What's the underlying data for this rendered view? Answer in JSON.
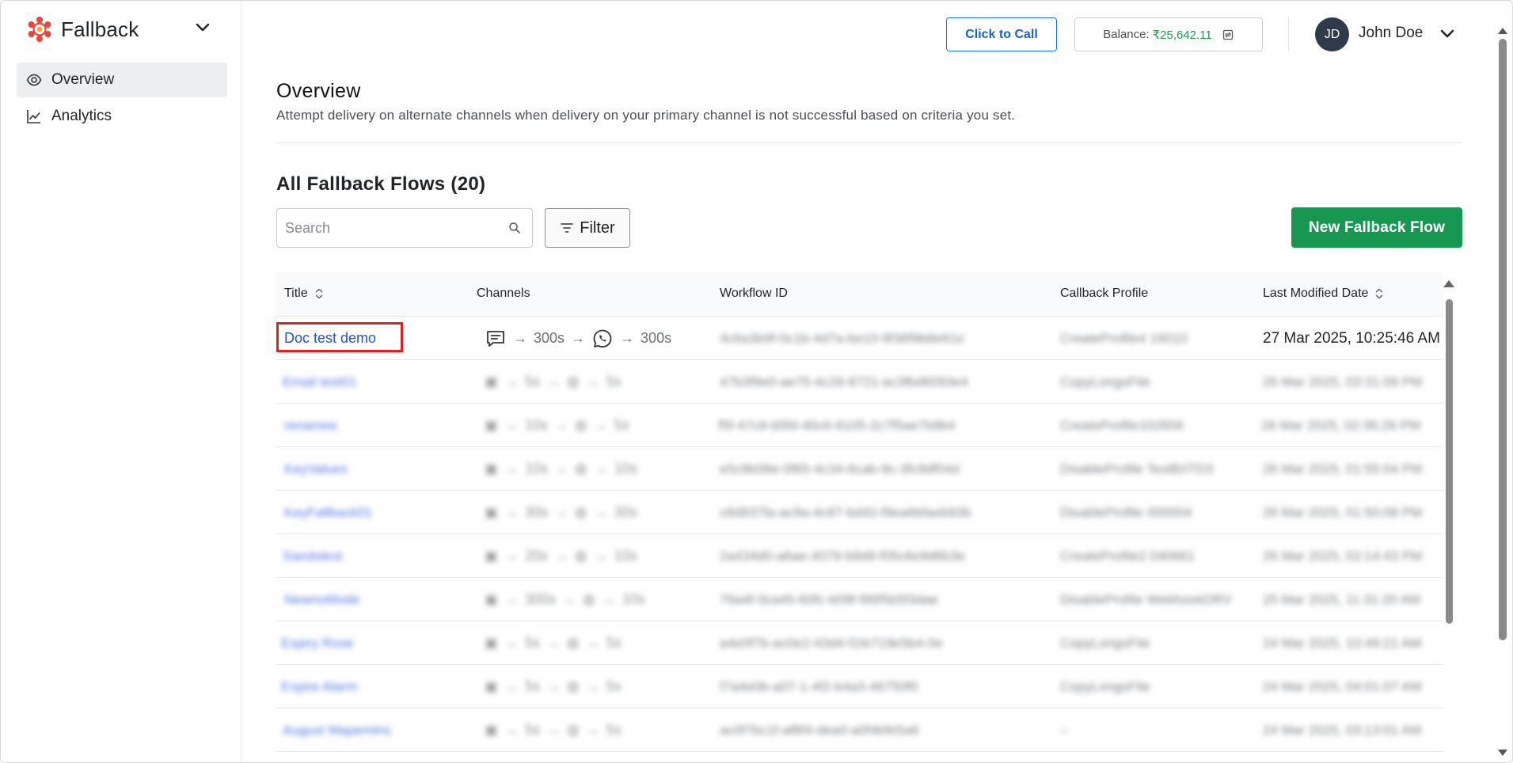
{
  "sidebar": {
    "brand": "Fallback",
    "items": [
      {
        "label": "Overview",
        "icon": "eye-icon",
        "active": true
      },
      {
        "label": "Analytics",
        "icon": "line-chart-icon",
        "active": false
      }
    ]
  },
  "header": {
    "call_button": "Click to Call",
    "balance_label": "Balance:",
    "balance_amount": "₹25,642.11",
    "user_initials": "JD",
    "user_name": "John Doe"
  },
  "page": {
    "title": "Overview",
    "description": "Attempt delivery on alternate channels when delivery on your primary channel is not successful based on criteria you set.",
    "section_title": "All Fallback Flows (20)"
  },
  "toolbar": {
    "search_placeholder": "Search",
    "filter_label": "Filter",
    "new_button": "New Fallback Flow"
  },
  "table": {
    "columns": [
      "Title",
      "Channels",
      "Workflow ID",
      "Callback Profile",
      "Last Modified Date"
    ],
    "rows": [
      {
        "title": "Doc test demo",
        "channel_1": "sms",
        "delay_1": "300s",
        "channel_2": "whatsapp",
        "delay_2": "300s",
        "workflow_id": "4c6a3b9f-0c1b-4d7a-be10-9f38f9b8e61e",
        "callback_profile": "CreateProfile4 16010",
        "modified": "27 Mar 2025, 10:25:46 AM"
      },
      {
        "title": "Email test01",
        "channel_1": "sms",
        "delay_1": "5s",
        "channel_2": "whatsapp",
        "delay_2": "5s",
        "workflow_id": "47b3f9e0-ae75-4c28-8721-ac3fbd6093e4",
        "callback_profile": "CopyLongsFile",
        "modified": "26 Mar 2025, 03:31:09 PM"
      },
      {
        "title": "renamee",
        "channel_1": "sms",
        "delay_1": "10s",
        "channel_2": "whatsapp",
        "delay_2": "5s",
        "workflow_id": "f5f-47c8-b5fd-40c6-8105-2c7f5ae7b9b4",
        "callback_profile": "CreateProfile102656",
        "modified": "26 Mar 2025, 02:36:26 PM"
      },
      {
        "title": "KeyValues",
        "channel_1": "sms",
        "delay_1": "10s",
        "channel_2": "whatsapp",
        "delay_2": "10s",
        "workflow_id": "e5c9b08e-0f85-4c34-8cab-9c-3fc9df04d",
        "callback_profile": "DisableProfile TestBriTD3",
        "modified": "26 Mar 2025, 01:55:04 PM"
      },
      {
        "title": "KeyFallback01",
        "channel_1": "sms",
        "delay_1": "30s",
        "channel_2": "whatsapp",
        "delay_2": "30s",
        "workflow_id": "c8d937fa-ac9a-4c87-bd42-f9ea6bfaeb93b",
        "callback_profile": "DisableProfile 000004",
        "modified": "26 Mar 2025, 01:50:08 PM"
      },
      {
        "title": "Sandstest",
        "channel_1": "sms",
        "delay_1": "20s",
        "channel_2": "whatsapp",
        "delay_2": "10s",
        "workflow_id": "2a434d0-a6ae-4079-b9d9-f05c6e9d6b3e",
        "callback_profile": "CreateProfile2 040661",
        "modified": "26 Mar 2025, 02:14:43 PM"
      },
      {
        "title": "NewnoMode",
        "channel_1": "sms",
        "delay_1": "300s",
        "channel_2": "whatsapp",
        "delay_2": "10s",
        "workflow_id": "76a4f-0ca45-60fc-b09f-f86f5b5f3dae",
        "callback_profile": "DisableProfile WebhookDRV",
        "modified": "25 Mar 2025, 11:31:20 AM"
      },
      {
        "title": "Expiry Rose",
        "channel_1": "sms",
        "delay_1": "5s",
        "channel_2": "whatsapp",
        "delay_2": "5s",
        "workflow_id": "a4e0f7b-ac0e2-43d4-f1fe719e5b4-0e",
        "callback_profile": "CopyLongsFile",
        "modified": "24 Mar 2025, 10:49:21 AM"
      },
      {
        "title": "Expire Alarm",
        "channel_1": "sms",
        "delay_1": "5s",
        "channel_2": "whatsapp",
        "delay_2": "5s",
        "workflow_id": "f7a4e0b-a07-1-4f2-b4a3-46750f0",
        "callback_profile": "CopyLongsFile",
        "modified": "24 Mar 2025, 04:01:07 AM"
      },
      {
        "title": "August Mapemtns",
        "channel_1": "sms",
        "delay_1": "5s",
        "channel_2": "whatsapp",
        "delay_2": "5s",
        "workflow_id": "ac0f7bc1f-af8f4-dea0-a0f4bfe5a6",
        "callback_profile": "–",
        "modified": "24 Mar 2025, 03:13:01 AM"
      }
    ]
  }
}
